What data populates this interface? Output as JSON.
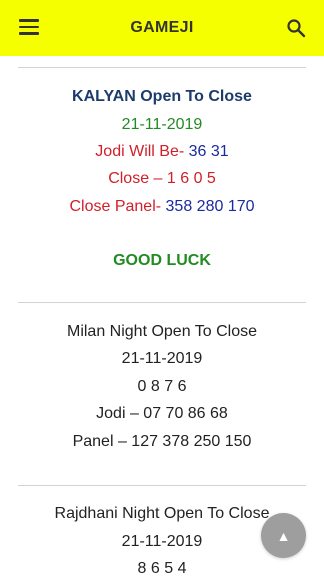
{
  "app": {
    "title": "GAMEJI",
    "menu_icon": "hamburger-menu-icon",
    "search_icon": "search-icon",
    "bar_color": "#f6ff00"
  },
  "posts": [
    {
      "heading": "KALYAN Open To Close",
      "date": "21-11-2019",
      "jodi_label": "Jodi Will Be-",
      "jodi_value": "36 31",
      "close_label": "Close – 1 6 0 5",
      "panel_label": "Close Panel-",
      "panel_value": "358 280 170",
      "footer": "GOOD LUCK"
    },
    {
      "heading": "Milan Night Open To Close",
      "date": "21-11-2019",
      "digits": "0 8 7 6",
      "jodi": "Jodi – 07 70 86 68",
      "panel": "Panel – 127 378 250 150"
    },
    {
      "heading": "Rajdhani Night Open To Close",
      "date": "21-11-2019",
      "digits": "8 6 5 4"
    }
  ],
  "fab": {
    "icon": "scroll-to-top-arrow-icon",
    "glyph": "▲"
  },
  "colors": {
    "navy": "#1d3c6b",
    "green": "#228b22",
    "red": "#d0202a",
    "blue": "#1a2aa0"
  }
}
